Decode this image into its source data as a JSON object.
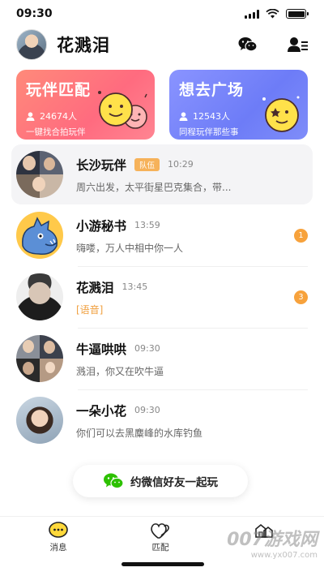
{
  "status": {
    "time": "09:30"
  },
  "header": {
    "title": "花溅泪",
    "avatar_icon": "user-avatar",
    "actions": [
      {
        "icon": "wechat-icon"
      },
      {
        "icon": "contacts-icon"
      }
    ]
  },
  "cards": [
    {
      "title": "玩伴匹配",
      "count": "24674人",
      "subtitle": "一键找合拍玩伴",
      "color": "#ff7b86",
      "icon": "smiley-faces"
    },
    {
      "title": "想去广场",
      "count": "12543人",
      "subtitle": "同程玩伴那些事",
      "color": "#7b87f8",
      "icon": "star-smiley"
    }
  ],
  "chats": [
    {
      "name": "长沙玩伴",
      "tag": "队伍",
      "time": "10:29",
      "message": "周六出发，太平街星巴克集合，带...",
      "unread": "",
      "avatar": "group-avatar"
    },
    {
      "name": "小游秘书",
      "tag": "",
      "time": "13:59",
      "message": "嗨喽，万人中相中你一人",
      "unread": "1",
      "avatar": "blue-creature"
    },
    {
      "name": "花溅泪",
      "tag": "",
      "time": "13:45",
      "message": "[语音]",
      "unread": "3",
      "avatar": "man-portrait"
    },
    {
      "name": "牛逼哄哄",
      "tag": "",
      "time": "09:30",
      "message": "溅泪，你又在吹牛逼",
      "unread": "",
      "avatar": "group-avatar"
    },
    {
      "name": "一朵小花",
      "tag": "",
      "time": "09:30",
      "message": "你们可以去黑麋峰的水库钓鱼",
      "unread": "",
      "avatar": "woman-portrait"
    }
  ],
  "invite": {
    "label": "约微信好友一起玩",
    "icon": "wechat-icon"
  },
  "tabs": [
    {
      "label": "消息",
      "icon": "message-icon",
      "active": true
    },
    {
      "label": "匹配",
      "icon": "heart-icon",
      "active": false
    },
    {
      "label": "",
      "icon": "plaza-icon",
      "active": false
    }
  ],
  "watermark": {
    "main": "007游戏网",
    "url": "www.yx007.com"
  },
  "colors": {
    "accent_orange": "#f7a23c",
    "card_red": "#ff7b86",
    "card_blue": "#7b87f8",
    "wechat_green": "#2dc100"
  }
}
